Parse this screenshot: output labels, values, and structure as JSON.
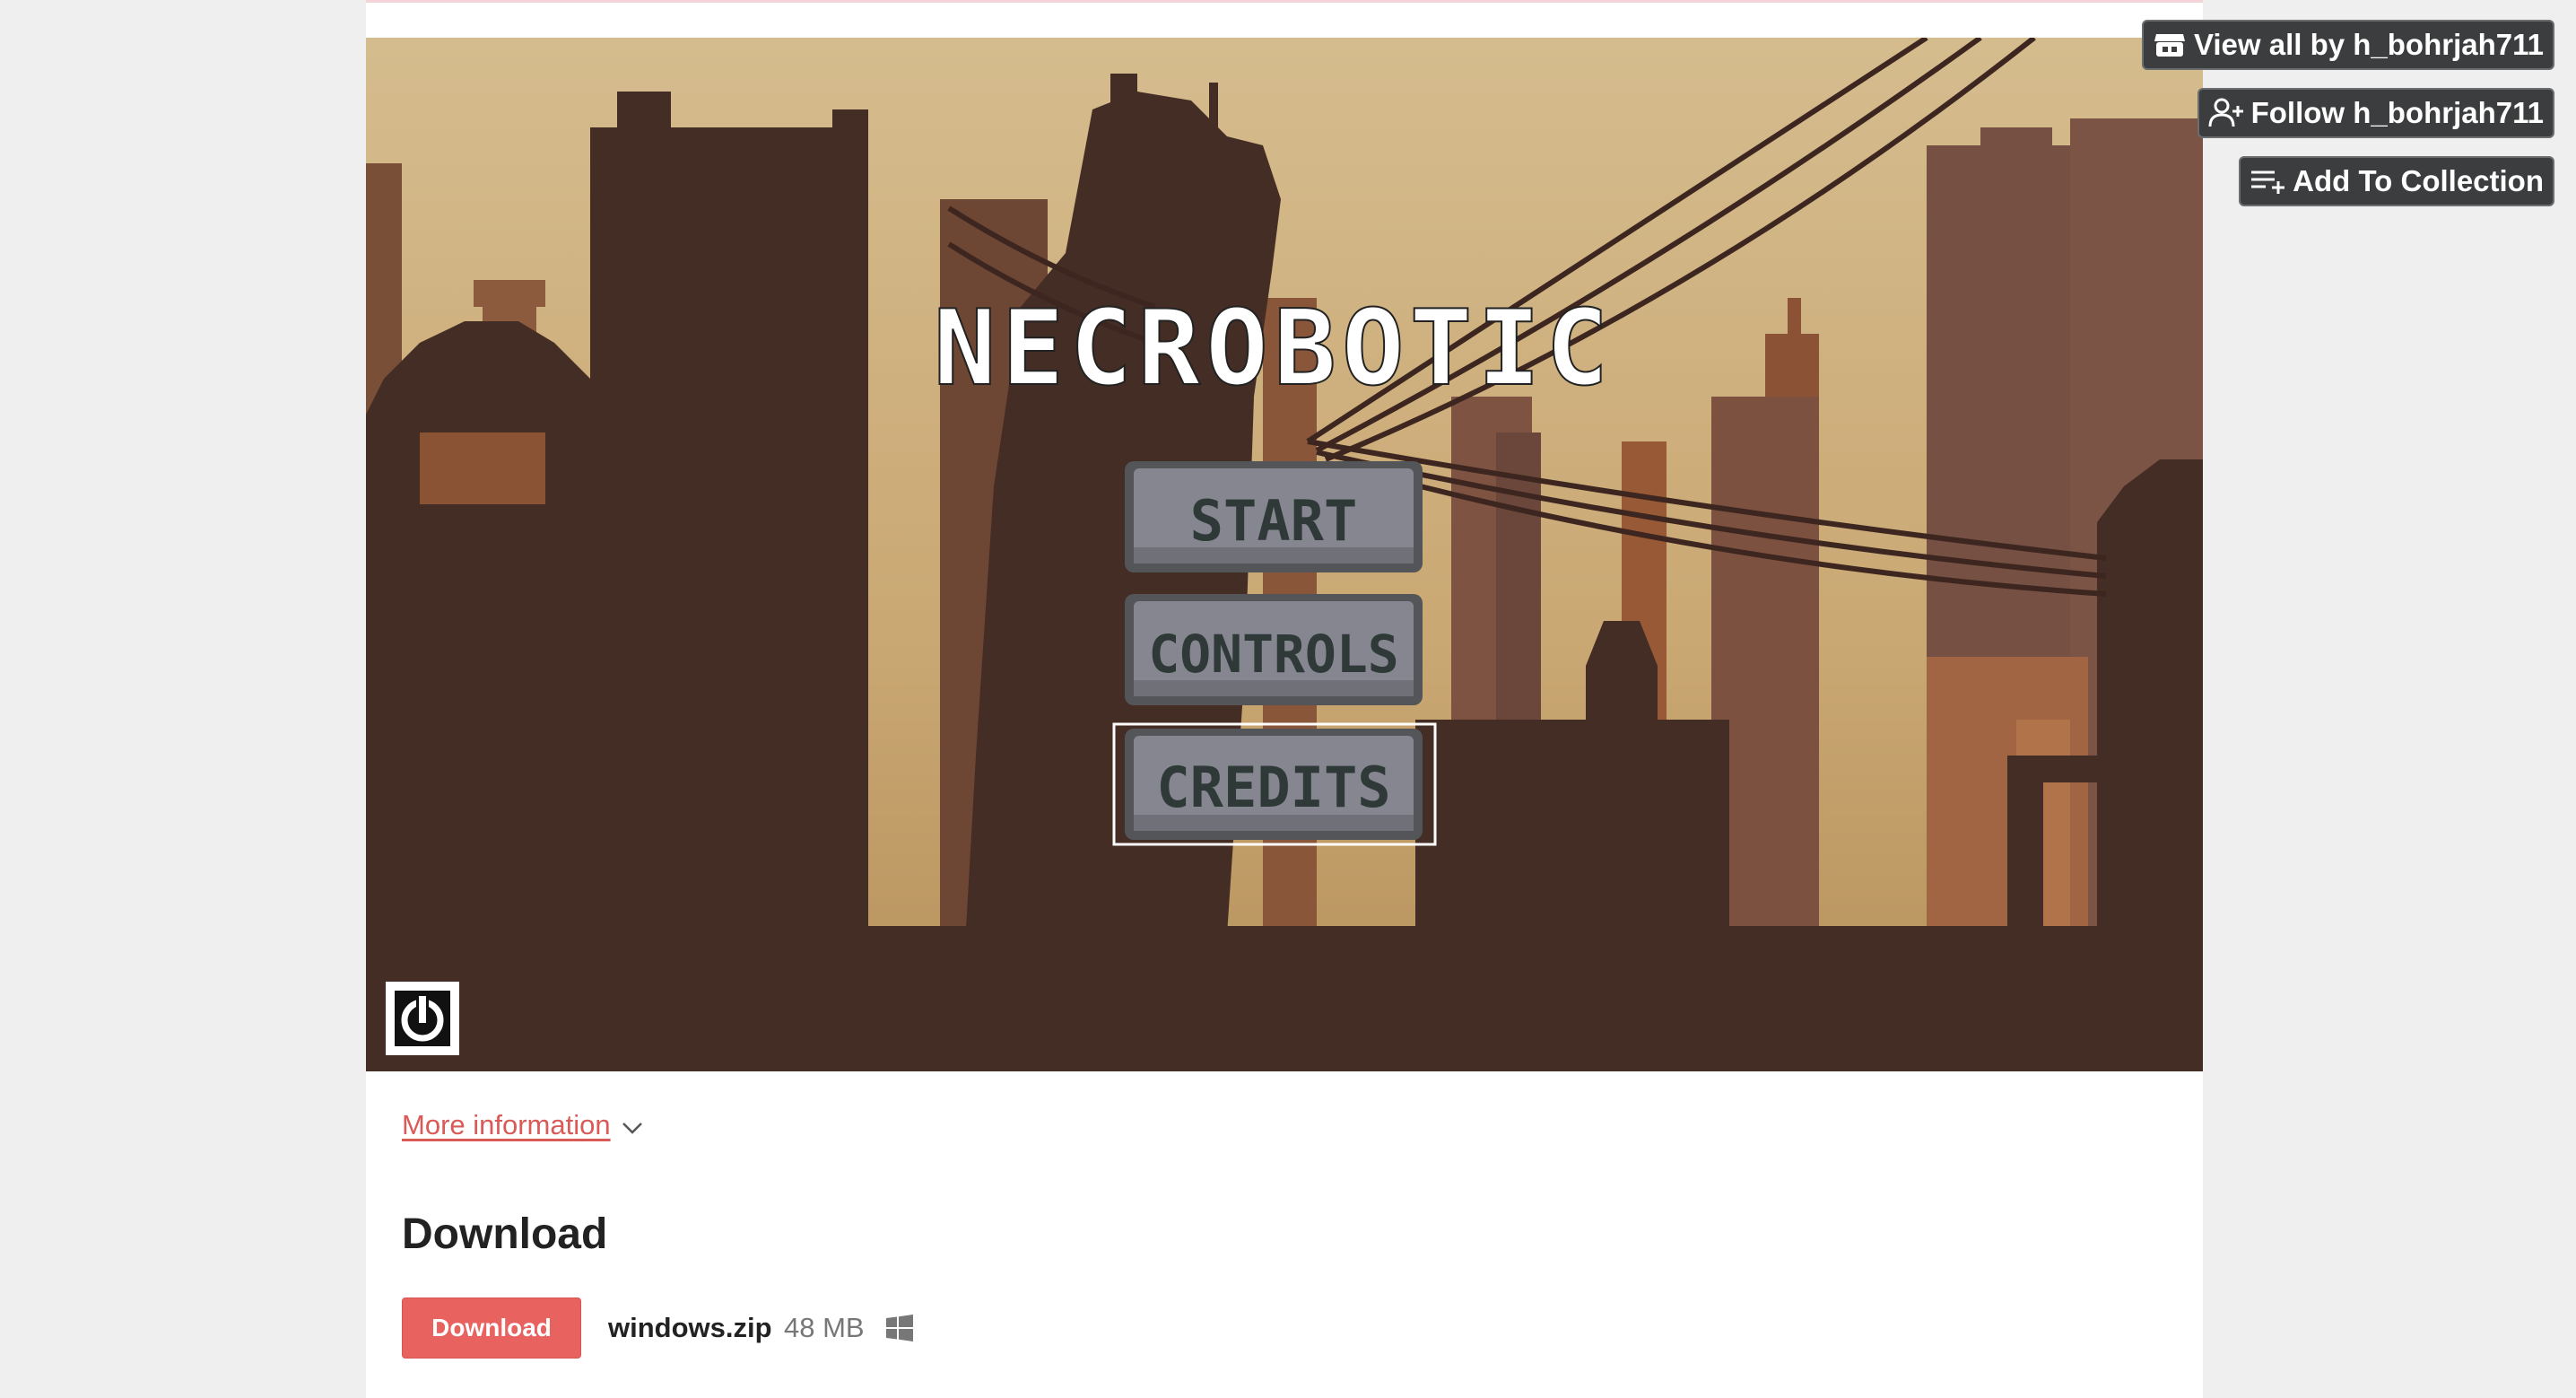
{
  "header": {
    "view_all_label": "View all by h_bohrjah711",
    "follow_label": "Follow h_bohrjah711",
    "collection_label": "Add To Collection"
  },
  "game": {
    "title": "NECROBOTIC",
    "menu": [
      "START",
      "CONTROLS",
      "CREDITS"
    ],
    "selected_item": "CREDITS",
    "power_icon": "power-icon"
  },
  "more_info": {
    "label": "More information",
    "icon": "chevron-down-icon"
  },
  "download": {
    "heading": "Download",
    "button_label": "Download",
    "file_name": "windows.zip",
    "file_size": "48 MB",
    "platform_icon": "windows-icon"
  },
  "colors": {
    "accent": "#e8625f",
    "link": "#da5a57",
    "scene_dark": "#442d25",
    "scene_sky": "#d2b98a",
    "top_button_bg": "#3b3d3e"
  }
}
